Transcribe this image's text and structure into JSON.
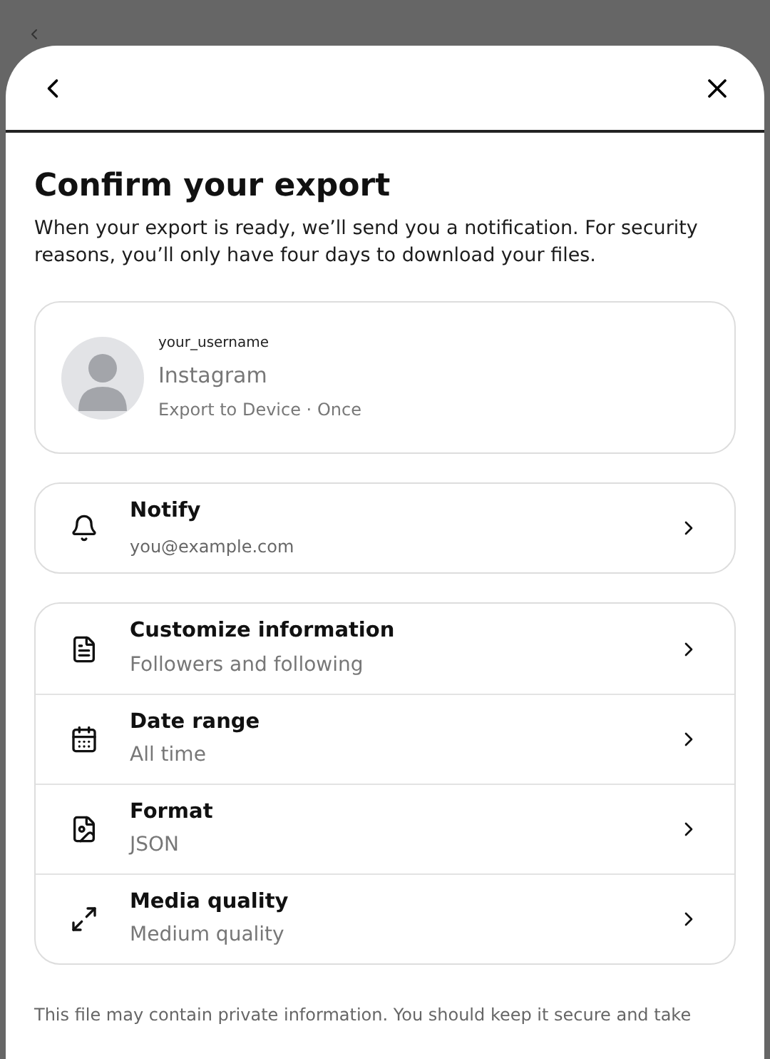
{
  "title": "Confirm your export",
  "description": "When your export is ready, we’ll send you a notification. For security reasons, you’ll only have four days to download your files.",
  "account": {
    "username": "your_username",
    "app": "Instagram",
    "destination": "Export to Device · Once"
  },
  "notify": {
    "label": "Notify",
    "value": "you@example.com"
  },
  "settings": [
    {
      "label": "Customize information",
      "value": "Followers and following"
    },
    {
      "label": "Date range",
      "value": "All time"
    },
    {
      "label": "Format",
      "value": "JSON"
    },
    {
      "label": "Media quality",
      "value": "Medium quality"
    }
  ],
  "footer_note": "This file may contain private information. You should keep it secure and take"
}
